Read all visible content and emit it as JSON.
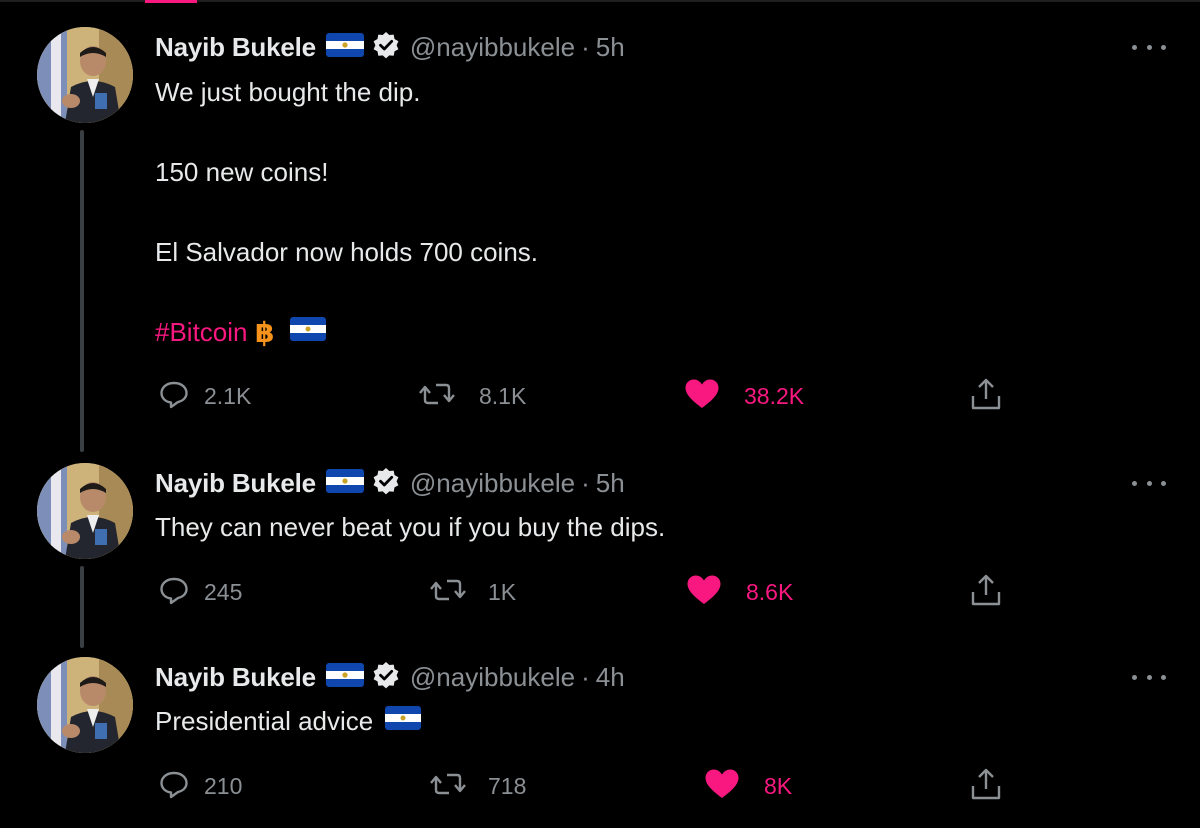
{
  "author": {
    "name": "Nayib Bukele",
    "handle": "@nayibbukele"
  },
  "colors": {
    "background": "#000000",
    "text": "#e7e9ea",
    "muted": "#8b9095",
    "like": "#f91880",
    "hashtag": "#f91880",
    "bitcoin": "#f7931a"
  },
  "tweets": [
    {
      "time": "5h",
      "lines": [
        "We just bought the dip.",
        "150 new coins!",
        "El Salvador now holds 700 coins."
      ],
      "hashtag": "#Bitcoin",
      "replies": "2.1K",
      "retweets": "8.1K",
      "likes": "38.2K"
    },
    {
      "time": "5h",
      "lines": [
        "They can never beat you if you buy the dips."
      ],
      "replies": "245",
      "retweets": "1K",
      "likes": "8.6K"
    },
    {
      "time": "4h",
      "lines": [
        "Presidential advice"
      ],
      "replies": "210",
      "retweets": "718",
      "likes": "8K"
    }
  ],
  "icons": [
    "flag-el-salvador-icon",
    "verified-badge-icon",
    "more-options-icon",
    "reply-icon",
    "retweet-icon",
    "like-heart-icon",
    "share-icon",
    "bitcoin-icon"
  ]
}
